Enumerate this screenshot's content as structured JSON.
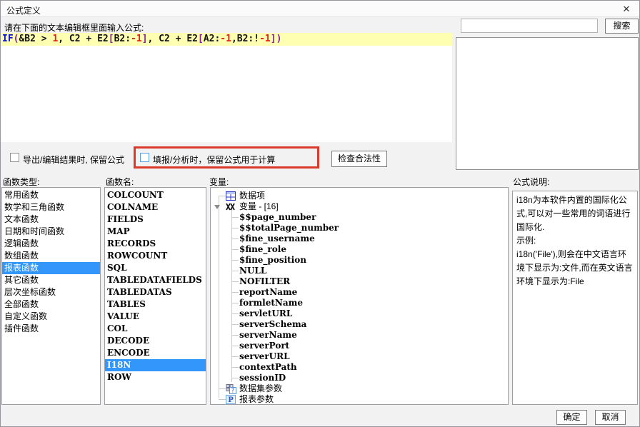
{
  "window": {
    "title": "公式定义",
    "close_glyph": "✕"
  },
  "prompt": "请在下面的文本编辑框里面输入公式:",
  "formula": {
    "tokens": [
      {
        "t": "IF",
        "c": "kw"
      },
      {
        "t": "(",
        "c": "br"
      },
      {
        "t": "&B2 > ",
        "c": "tx"
      },
      {
        "t": "1",
        "c": "num"
      },
      {
        "t": ", C2 + E2",
        "c": "tx"
      },
      {
        "t": "[",
        "c": "br"
      },
      {
        "t": "B2:",
        "c": "tx"
      },
      {
        "t": "-1",
        "c": "num"
      },
      {
        "t": "]",
        "c": "br"
      },
      {
        "t": ", C2 + E2",
        "c": "tx"
      },
      {
        "t": "[",
        "c": "br"
      },
      {
        "t": "A2:",
        "c": "tx"
      },
      {
        "t": "-1",
        "c": "num"
      },
      {
        "t": ",B2:!",
        "c": "tx"
      },
      {
        "t": "-1",
        "c": "num"
      },
      {
        "t": "]",
        "c": "br"
      },
      {
        "t": ")",
        "c": "br"
      }
    ]
  },
  "search": {
    "value": "",
    "button_label": "搜索"
  },
  "options": {
    "checkbox1": {
      "label": "导出/编辑结果时, 保留公式",
      "checked": false
    },
    "checkbox2": {
      "label": "填报/分析时，保留公式用于计算",
      "checked": false,
      "highlighted": true
    },
    "check_button_label": "检查合法性"
  },
  "columns": {
    "types": {
      "header": "函数类型:",
      "selected_index": 6,
      "items": [
        "常用函数",
        "数学和三角函数",
        "文本函数",
        "日期和时间函数",
        "逻辑函数",
        "数组函数",
        "报表函数",
        "其它函数",
        "层次坐标函数",
        "全部函数",
        "自定义函数",
        "插件函数"
      ]
    },
    "names": {
      "header": "函数名:",
      "selected_index": 14,
      "items": [
        "COLCOUNT",
        "COLNAME",
        "FIELDS",
        "MAP",
        "RECORDS",
        "ROWCOUNT",
        "SQL",
        "TABLEDATAFIELDS",
        "TABLEDATAS",
        "TABLES",
        "VALUE",
        "COL",
        "DECODE",
        "ENCODE",
        "I18N",
        "ROW"
      ]
    },
    "variables": {
      "header": "变量:",
      "tree": [
        {
          "label": "数据项",
          "level": 1,
          "icon": "data-item-icon"
        },
        {
          "label": "变量 - [16]",
          "level": 1,
          "icon": "variable-icon",
          "expander": true
        },
        {
          "label": "$$page_number",
          "level": 2
        },
        {
          "label": "$$totalPage_number",
          "level": 2
        },
        {
          "label": "$fine_username",
          "level": 2
        },
        {
          "label": "$fine_role",
          "level": 2
        },
        {
          "label": "$fine_position",
          "level": 2
        },
        {
          "label": "NULL",
          "level": 2
        },
        {
          "label": "NOFILTER",
          "level": 2
        },
        {
          "label": "reportName",
          "level": 2
        },
        {
          "label": "formletName",
          "level": 2
        },
        {
          "label": "servletURL",
          "level": 2
        },
        {
          "label": "serverSchema",
          "level": 2
        },
        {
          "label": "serverName",
          "level": 2
        },
        {
          "label": "serverPort",
          "level": 2
        },
        {
          "label": "serverURL",
          "level": 2
        },
        {
          "label": "contextPath",
          "level": 2
        },
        {
          "label": "sessionID",
          "level": 2
        },
        {
          "label": "数据集参数",
          "level": 1,
          "icon": "dataset-param-icon"
        },
        {
          "label": "报表参数",
          "level": 1,
          "icon": "report-param-icon"
        }
      ]
    },
    "description": {
      "header": "公式说明:",
      "lines": [
        "i18n为本软件内置的国际化公式,可以对一些常用的词语进行国际化.",
        "示例:",
        "i18n('File'),则会在中文语言环境下显示为:文件,而在英文语言环境下显示为:File"
      ]
    }
  },
  "footer": {
    "ok_label": "确定",
    "cancel_label": "取消"
  },
  "colors": {
    "selection": "#3296fa",
    "formula_line_bg": "#ffffb1",
    "highlight_rect": "#d93a2b",
    "keyword": "#0a13cf",
    "bracket": "#8a1f9c",
    "number": "#e3201b"
  }
}
